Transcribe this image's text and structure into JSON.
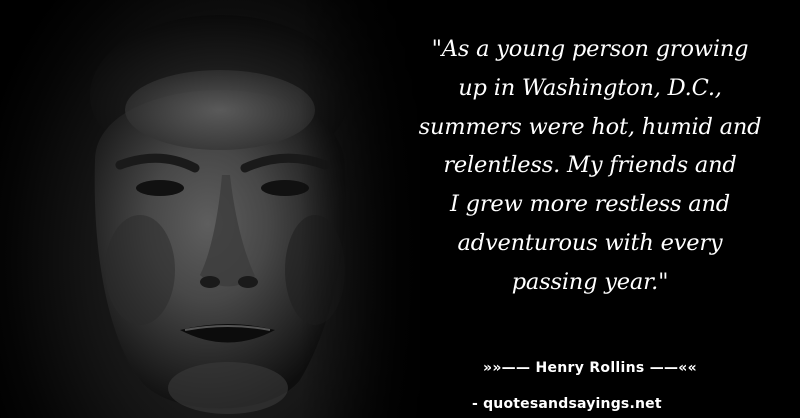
{
  "quote": {
    "text": "\"As a young person growing up in Washington, D.C., summers were hot, humid and relentless. My friends and I grew more restless and adventurous with every passing year.\"",
    "lines": [
      "\"As a young person growing",
      "up in Washington, D.C.,",
      "summers were hot, humid and",
      "relentless. My friends and",
      "I grew more restless and",
      "adventurous with every",
      "passing year.\""
    ]
  },
  "attribution": {
    "text": "»»—— Henry Rollins ——««"
  },
  "site": {
    "text": "- quotesandsayings.net"
  },
  "colors": {
    "background": "#000000",
    "text": "#ffffff"
  }
}
